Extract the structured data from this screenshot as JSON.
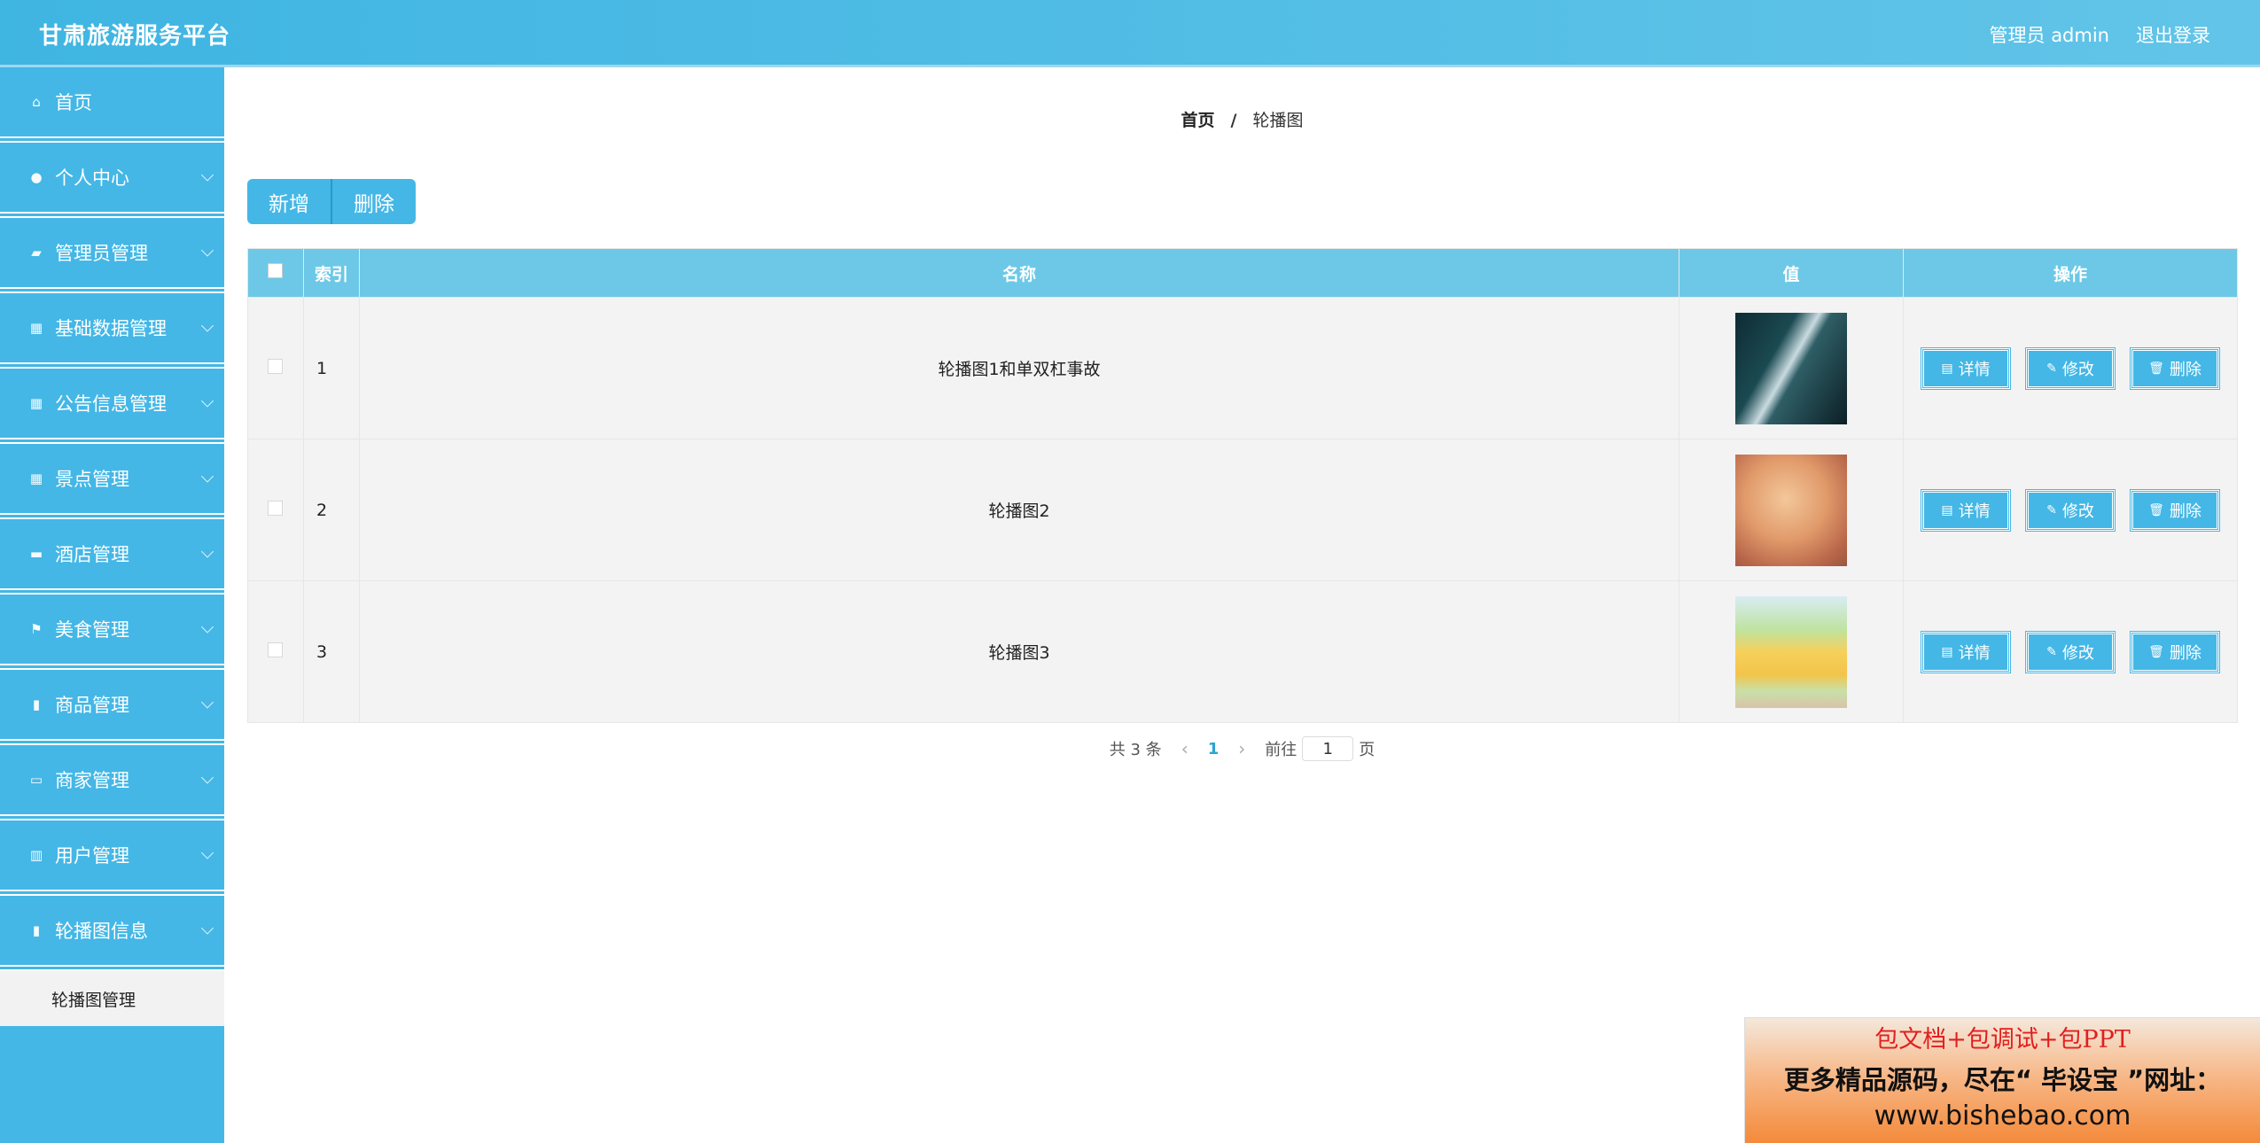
{
  "header": {
    "title": "甘肃旅游服务平台",
    "user_label": "管理员 admin",
    "logout_label": "退出登录"
  },
  "sidebar": {
    "items": [
      {
        "label": "首页",
        "icon": "home-icon"
      },
      {
        "label": "个人中心",
        "icon": "user-icon"
      },
      {
        "label": "管理员管理",
        "icon": "admin-icon"
      },
      {
        "label": "基础数据管理",
        "icon": "grid-icon"
      },
      {
        "label": "公告信息管理",
        "icon": "grid-icon"
      },
      {
        "label": "景点管理",
        "icon": "grid-icon"
      },
      {
        "label": "酒店管理",
        "icon": "briefcase-icon"
      },
      {
        "label": "美食管理",
        "icon": "flag-icon"
      },
      {
        "label": "商品管理",
        "icon": "clipboard-icon"
      },
      {
        "label": "商家管理",
        "icon": "monitor-icon"
      },
      {
        "label": "用户管理",
        "icon": "building-icon"
      },
      {
        "label": "轮播图信息",
        "icon": "clipboard-icon"
      }
    ],
    "submenu": {
      "label": "轮播图管理"
    }
  },
  "breadcrumb": {
    "home": "首页",
    "separator": "/",
    "current": "轮播图"
  },
  "toolbar": {
    "add_label": "新增",
    "delete_label": "删除"
  },
  "table": {
    "columns": [
      "索引",
      "名称",
      "值",
      "操作"
    ],
    "rows": [
      {
        "index": "1",
        "name": "轮播图1和单双杠事故"
      },
      {
        "index": "2",
        "name": "轮播图2"
      },
      {
        "index": "3",
        "name": "轮播图3"
      }
    ],
    "actions": {
      "detail": "详情",
      "edit": "修改",
      "delete": "删除"
    }
  },
  "pagination": {
    "total_text": "共 3 条",
    "current_page": "1",
    "goto_label": "前往",
    "goto_value": "1",
    "page_suffix": "页"
  },
  "promo": {
    "line1": "包文档+包调试+包PPT",
    "line2": "更多精品源码，尽在“ 毕设宝 ”网址：",
    "line3": "www.bishebao.com"
  },
  "colors": {
    "primary": "#44b7e6",
    "table_header": "#6cc8e6",
    "row_bg": "#f3f3f3"
  }
}
